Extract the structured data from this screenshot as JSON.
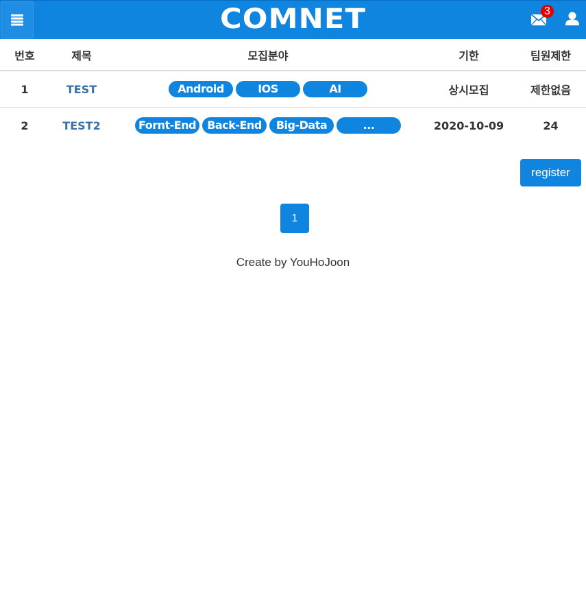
{
  "header": {
    "brand": "COMNET",
    "mail_badge_count": "3",
    "colors": {
      "bar": "#1085e0",
      "badge": "#e50000"
    },
    "icons": {
      "menu": "menu-icon",
      "mail": "mail-icon",
      "user": "user-icon"
    }
  },
  "table": {
    "headers": {
      "num": "번호",
      "title": "제목",
      "field": "모집분야",
      "deadline": "기한",
      "limit": "팀원제한"
    },
    "rows": [
      {
        "num": "1",
        "title": "TEST",
        "tags": [
          "Android",
          "IOS",
          "AI"
        ],
        "deadline": "상시모집",
        "limit": "제한없음"
      },
      {
        "num": "2",
        "title": "TEST2",
        "tags": [
          "Fornt-End",
          "Back-End",
          "Big-Data",
          "..."
        ],
        "deadline": "2020-10-09",
        "limit": "24"
      }
    ]
  },
  "actions": {
    "register_label": "register"
  },
  "pagination": {
    "current_page": "1"
  },
  "footer": {
    "text": "Create by YouHoJoon"
  }
}
